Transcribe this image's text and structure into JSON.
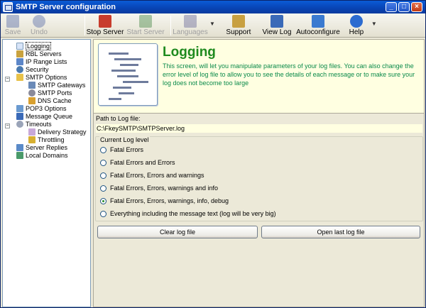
{
  "window": {
    "title": "SMTP Server configuration"
  },
  "toolbar": {
    "items": [
      {
        "label": "Save",
        "color": "#5a6ea8",
        "disabled": true
      },
      {
        "label": "Undo",
        "color": "#5a6ea8",
        "disabled": true
      },
      {
        "label": "Stop Server",
        "color": "#c83c2c",
        "disabled": false
      },
      {
        "label": "Start Server",
        "color": "#4a8a4a",
        "disabled": true
      },
      {
        "label": "Languages",
        "color": "#6a6a9a",
        "disabled": true
      },
      {
        "label": "Support",
        "color": "#c8a040",
        "disabled": false
      },
      {
        "label": "View Log",
        "color": "#3a6ab8",
        "disabled": false
      },
      {
        "label": "Autoconfigure",
        "color": "#3a7ad0",
        "disabled": false
      },
      {
        "label": "Help",
        "color": "#2b6bd0",
        "disabled": false
      }
    ]
  },
  "tree": {
    "items": [
      {
        "label": "Logging",
        "selected": true
      },
      {
        "label": "RBL Servers"
      },
      {
        "label": "IP Range Lists"
      },
      {
        "label": "Security"
      },
      {
        "label": "SMTP Options"
      },
      {
        "label": "SMTP Gateways"
      },
      {
        "label": "SMTP Ports"
      },
      {
        "label": "DNS Cache"
      },
      {
        "label": "POP3 Options"
      },
      {
        "label": "Message Queue"
      },
      {
        "label": "Timeouts"
      },
      {
        "label": "Delivery Strategy"
      },
      {
        "label": "Throttling"
      },
      {
        "label": "Server Replies"
      },
      {
        "label": "Local Domains"
      }
    ]
  },
  "header": {
    "title": "Logging",
    "description": "This screen, will let you manipulate parameters of your log files. You can also change the error level of log file to allow you to see the details of each message or to make sure your log does not become too large"
  },
  "log_path": {
    "label": "Path to Log file:",
    "value": "C:\\FkeySMTP\\SMTPServer.log"
  },
  "log_level": {
    "title": "Current Log level",
    "options": [
      {
        "label": "Fatal Errors",
        "selected": false
      },
      {
        "label": "Fatal Errors and Errors",
        "selected": false
      },
      {
        "label": "Fatal Errors, Errors and warnings",
        "selected": false
      },
      {
        "label": "Fatal Errors, Errors, warnings and  info",
        "selected": false
      },
      {
        "label": "Fatal Errors, Errors, warnings, info, debug",
        "selected": true
      },
      {
        "label": "Everything including the message text (log will be very big)",
        "selected": false
      }
    ]
  },
  "buttons": {
    "clear": "Clear log file",
    "open_last": "Open last log file"
  },
  "colors": {
    "title_green": "#1e8a1e",
    "desc_green": "#0a8a4a",
    "header_bg": "#ffffe1"
  }
}
